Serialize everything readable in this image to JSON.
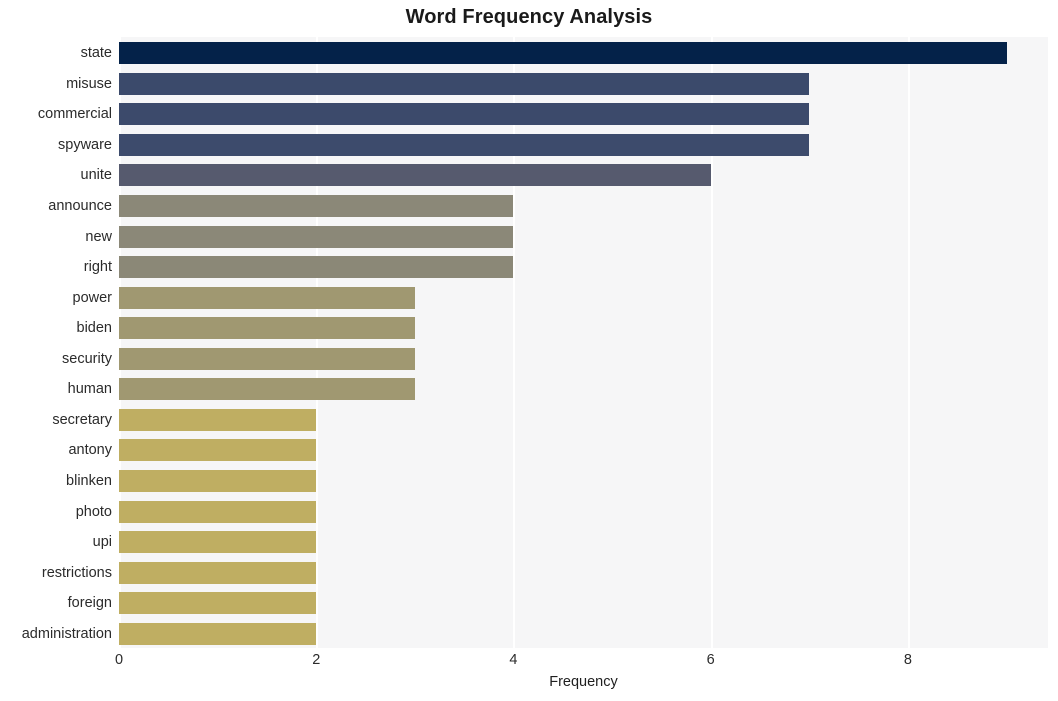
{
  "chart_data": {
    "type": "bar",
    "orientation": "horizontal",
    "title": "Word Frequency Analysis",
    "xlabel": "Frequency",
    "ylabel": "",
    "xlim": [
      0,
      9.42
    ],
    "xticks": [
      0,
      2,
      4,
      6,
      8
    ],
    "xtick_labels": [
      "0",
      "2",
      "4",
      "6",
      "8"
    ],
    "grid": "vertical",
    "legend": "none",
    "categories": [
      "state",
      "misuse",
      "commercial",
      "spyware",
      "unite",
      "announce",
      "new",
      "right",
      "power",
      "biden",
      "security",
      "human",
      "secretary",
      "antony",
      "blinken",
      "photo",
      "upi",
      "restrictions",
      "foreign",
      "administration"
    ],
    "values": [
      9,
      7,
      7,
      7,
      6,
      4,
      4,
      4,
      3,
      3,
      3,
      3,
      2,
      2,
      2,
      2,
      2,
      2,
      2,
      2
    ],
    "bar_colors": [
      "#042249",
      "#3b4a6b",
      "#3c4a6b",
      "#3d4b6c",
      "#565a6e",
      "#8b8878",
      "#8b8878",
      "#8b8877",
      "#a09871",
      "#a09871",
      "#a09871",
      "#a09871",
      "#bfae62",
      "#bfae62",
      "#bfae62",
      "#bfae62",
      "#bfae62",
      "#bfae62",
      "#bfae62",
      "#bfae62"
    ]
  },
  "style": {
    "plot_background": "#f6f6f7",
    "figure_background": "#ffffff",
    "gridline_color": "#ffffff",
    "text_color": "#2b2b2b",
    "title_color": "#1a1a1a"
  }
}
